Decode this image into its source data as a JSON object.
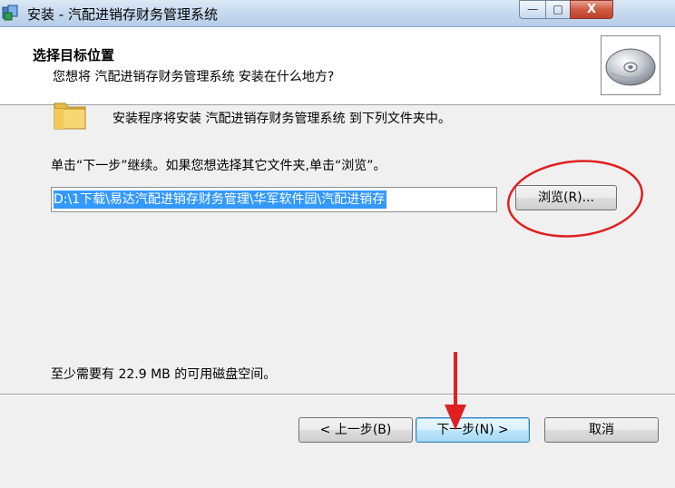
{
  "window": {
    "title": "安装 - 汽配进销存财务管理系统",
    "minimize": "—",
    "maximize": "□",
    "close": "X"
  },
  "header": {
    "title": "选择目标位置",
    "subtitle": "您想将 汽配进销存财务管理系统 安装在什么地方?"
  },
  "body": {
    "intro": "安装程序将安装 汽配进销存财务管理系统 到下列文件夹中。",
    "instruction": "单击“下一步”继续。如果您想选择其它文件夹,单击“浏览”。",
    "path_value": "D:\\1下载\\易达汽配进销存财务管理\\华军软件园\\汽配进销存",
    "browse_label": "浏览(R)...",
    "disk_space": "至少需要有 22.9 MB 的可用磁盘空间。"
  },
  "footer": {
    "back_label": "< 上一步(B)",
    "next_label": "下一步(N) >",
    "cancel_label": "取消"
  },
  "colors": {
    "selection": "#3399ff",
    "annotation": "#e02020",
    "dialog_bg": "#f0f0f0"
  }
}
